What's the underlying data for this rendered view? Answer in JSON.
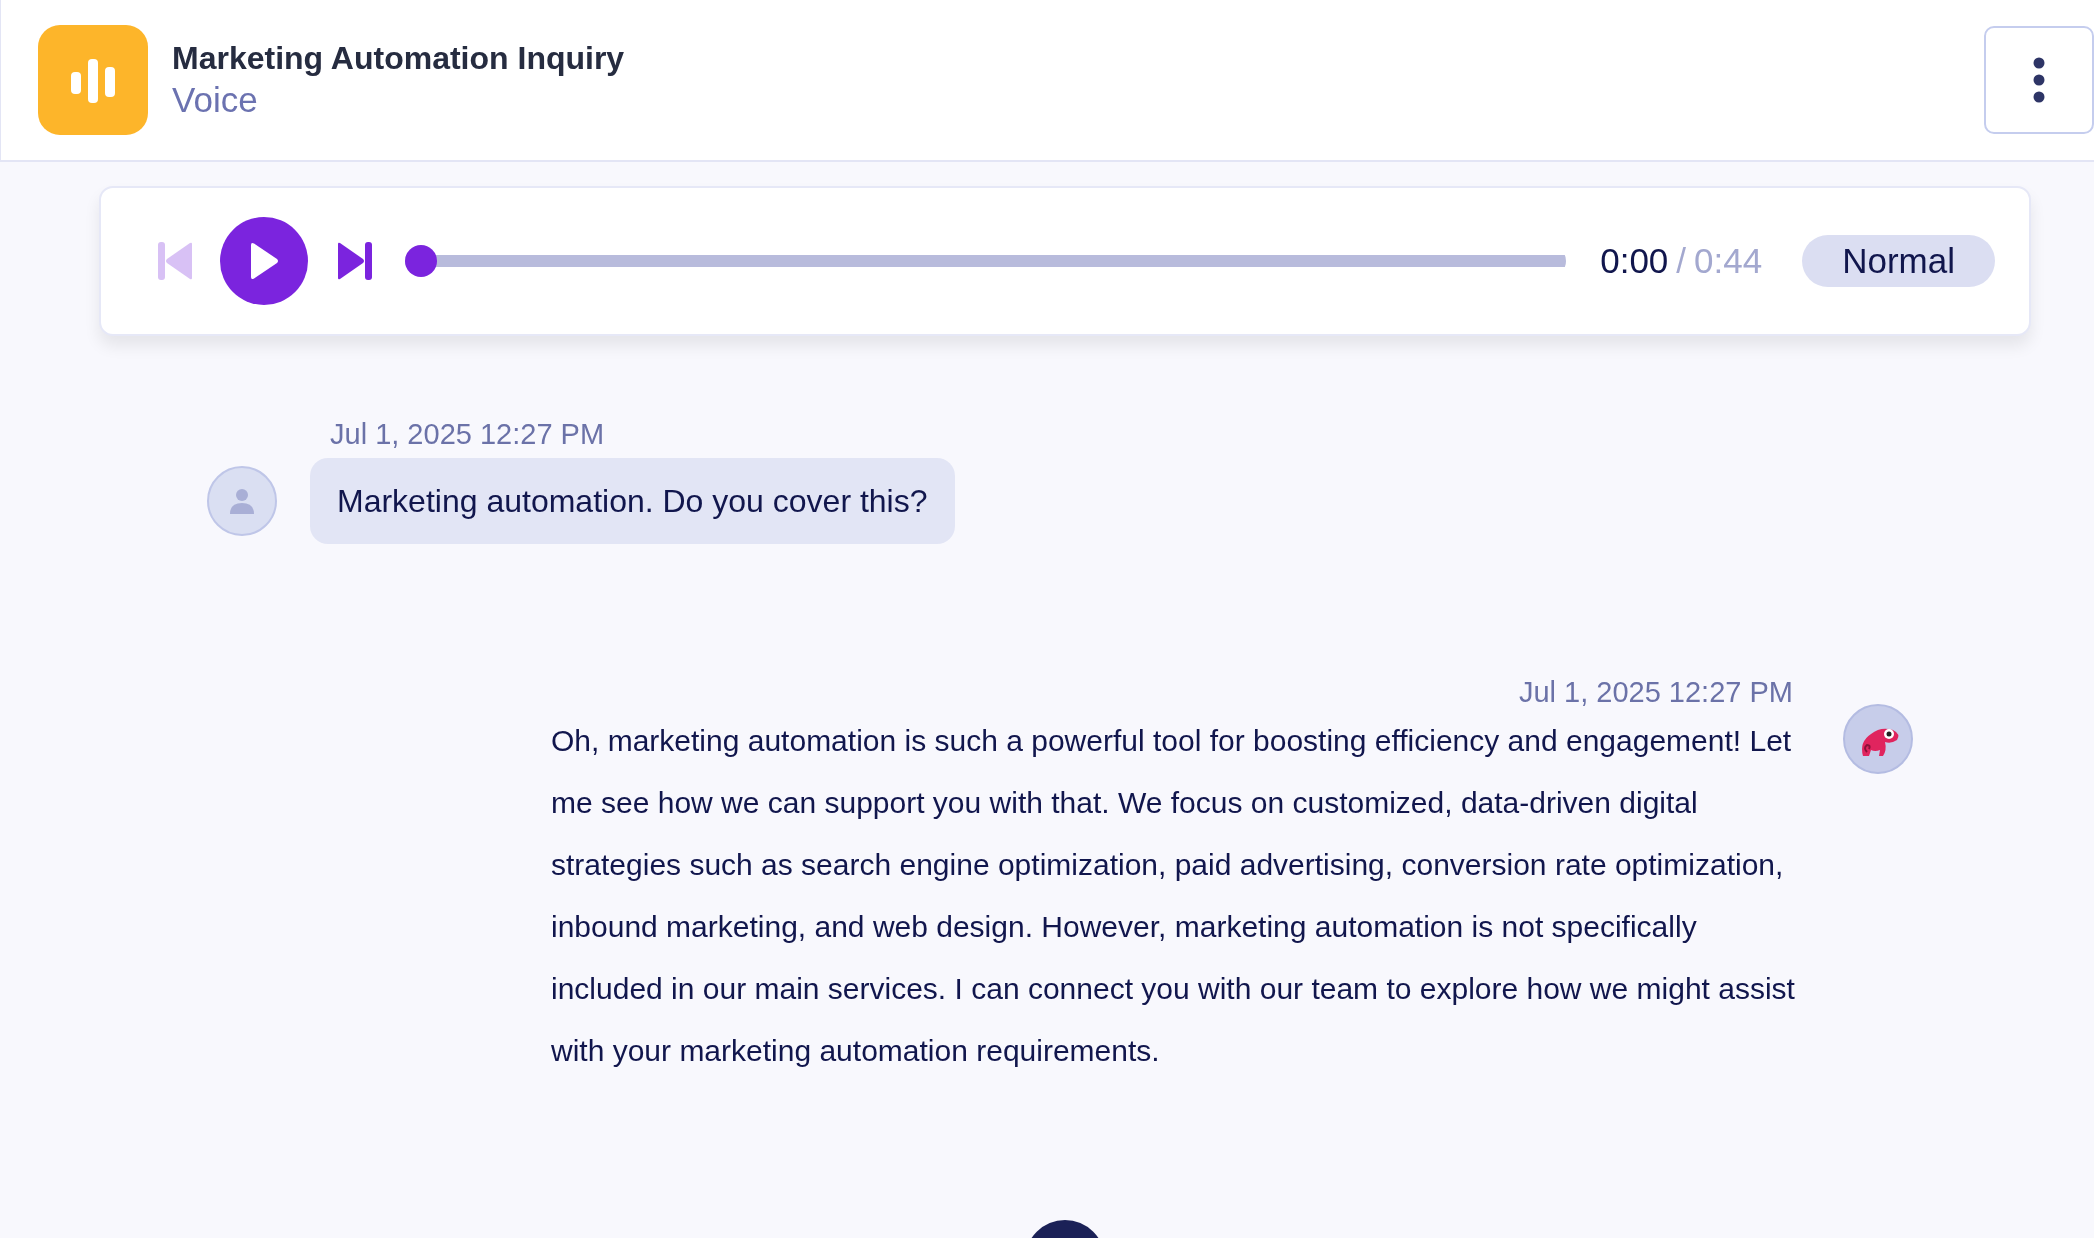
{
  "header": {
    "title": "Marketing Automation Inquiry",
    "subtitle": "Voice"
  },
  "player": {
    "current_time": "0:00",
    "separator": "/",
    "duration": "0:44",
    "speed": "Normal",
    "level": 0,
    "previous_disabled": true
  },
  "messages": [
    {
      "kind": "user",
      "timestamp": "Jul 1, 2025 12:27 PM",
      "text": "Marketing automation. Do you cover this?"
    },
    {
      "kind": "bot",
      "timestamp": "Jul 1, 2025 12:27 PM",
      "text": "Oh, marketing automation is such a powerful tool for boosting efficiency and engagement! Let me see how we can support you with that. We focus on customized, data-driven digital strategies such as search engine optimization, paid advertising, conversion rate optimization, inbound marketing, and web design. However, marketing automation is not specifically included in our main services. I can connect you with our team to explore how we might assist with your marketing automation requirements."
    }
  ]
}
